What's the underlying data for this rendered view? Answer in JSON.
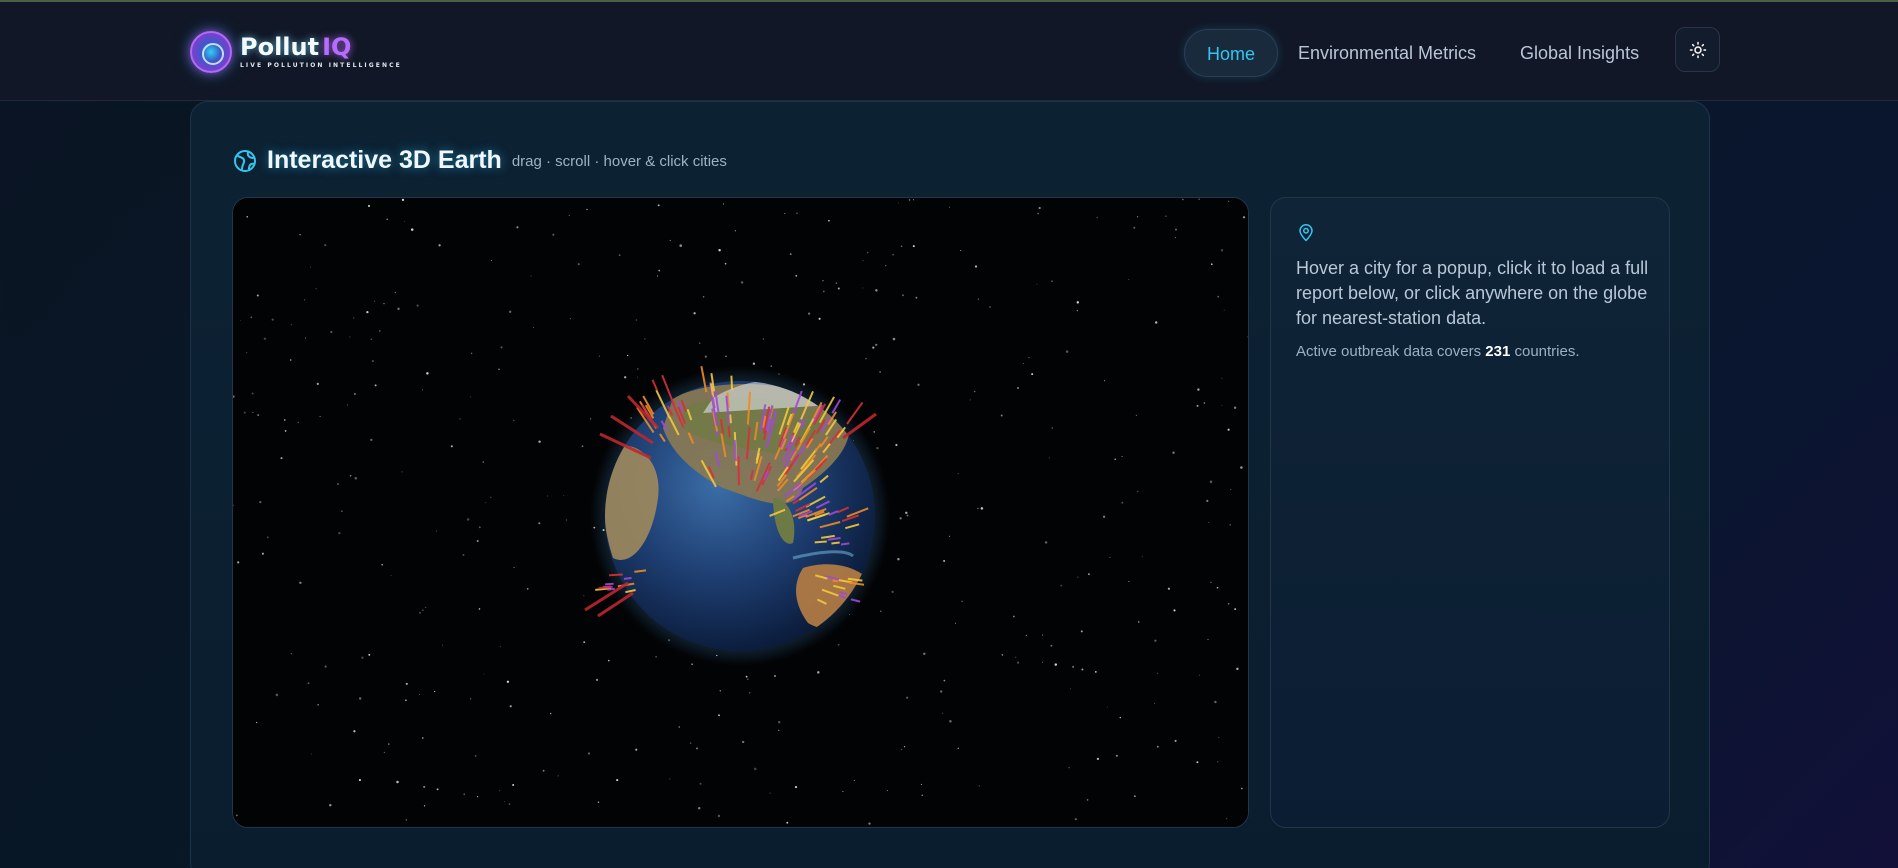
{
  "brand": {
    "name": "Pollut",
    "name_accent": "IQ",
    "tagline": "LIVE POLLUTION INTELLIGENCE"
  },
  "nav": {
    "items": [
      {
        "label": "Home",
        "active": true
      },
      {
        "label": "Environmental Metrics",
        "active": false
      },
      {
        "label": "Global Insights",
        "active": false
      }
    ],
    "theme_toggle_icon": "sun-icon"
  },
  "section": {
    "icon": "globe-icon",
    "title": "Interactive 3D Earth",
    "subtitle": "drag · scroll · hover & click cities"
  },
  "info_panel": {
    "icon": "map-pin-icon",
    "message": "Hover a city for a popup, click it to load a full report below, or click anywhere on the globe for nearest-station data.",
    "count_prefix": "Active outbreak data covers",
    "count_value": "231",
    "count_suffix": "countries."
  },
  "colors": {
    "accent": "#33c5f0",
    "brand_purple": "#b66cff",
    "bar_red": "#d6303a",
    "bar_orange": "#f08a24",
    "bar_yellow": "#f3c93a"
  }
}
